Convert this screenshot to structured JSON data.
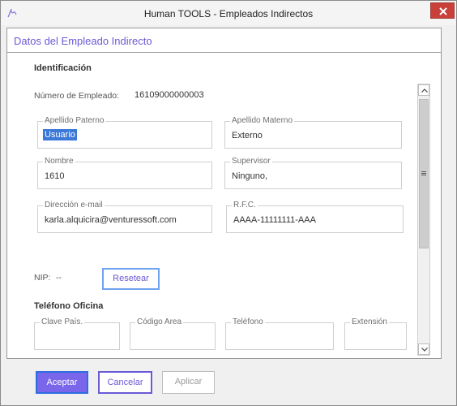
{
  "window": {
    "title": "Human TOOLS - Empleados Indirectos",
    "icon": "app-logo-icon",
    "close_icon": "close-icon"
  },
  "dialog": {
    "title": "Datos del Empleado Indirecto"
  },
  "identificacion": {
    "section_title": "Identificación",
    "employee_number_label": "Número de Empleado:",
    "employee_number_value": "16109000000003",
    "apellido_paterno": {
      "label": "Apellido Paterno",
      "value": "Usuario"
    },
    "apellido_materno": {
      "label": "Apellido Materno",
      "value": "Externo"
    },
    "nombre": {
      "label": "Nombre",
      "value": "1610"
    },
    "supervisor": {
      "label": "Supervisor",
      "value": "Ninguno,"
    },
    "email": {
      "label": "Dirección e-mail",
      "value": "karla.alquicira@venturessoft.com"
    },
    "rfc": {
      "label": "R.F.C.",
      "value": "AAAA-11111111-AAA"
    },
    "nip_label": "NIP:",
    "nip_value": "--",
    "reset_button": "Resetear"
  },
  "telefono_oficina": {
    "section_title": "Teléfono Oficina",
    "clave_pais": {
      "label": "Clave País.",
      "value": ""
    },
    "codigo_area": {
      "label": "Código Area",
      "value": ""
    },
    "telefono": {
      "label": "Teléfono",
      "value": ""
    },
    "extension": {
      "label": "Extensión",
      "value": ""
    }
  },
  "footer": {
    "accept": "Aceptar",
    "cancel": "Cancelar",
    "apply": "Aplicar"
  },
  "colors": {
    "accent": "#7a66ea",
    "title_purple": "#6a5ad6",
    "close_red": "#c9403a",
    "selection_blue": "#3b78d8"
  }
}
